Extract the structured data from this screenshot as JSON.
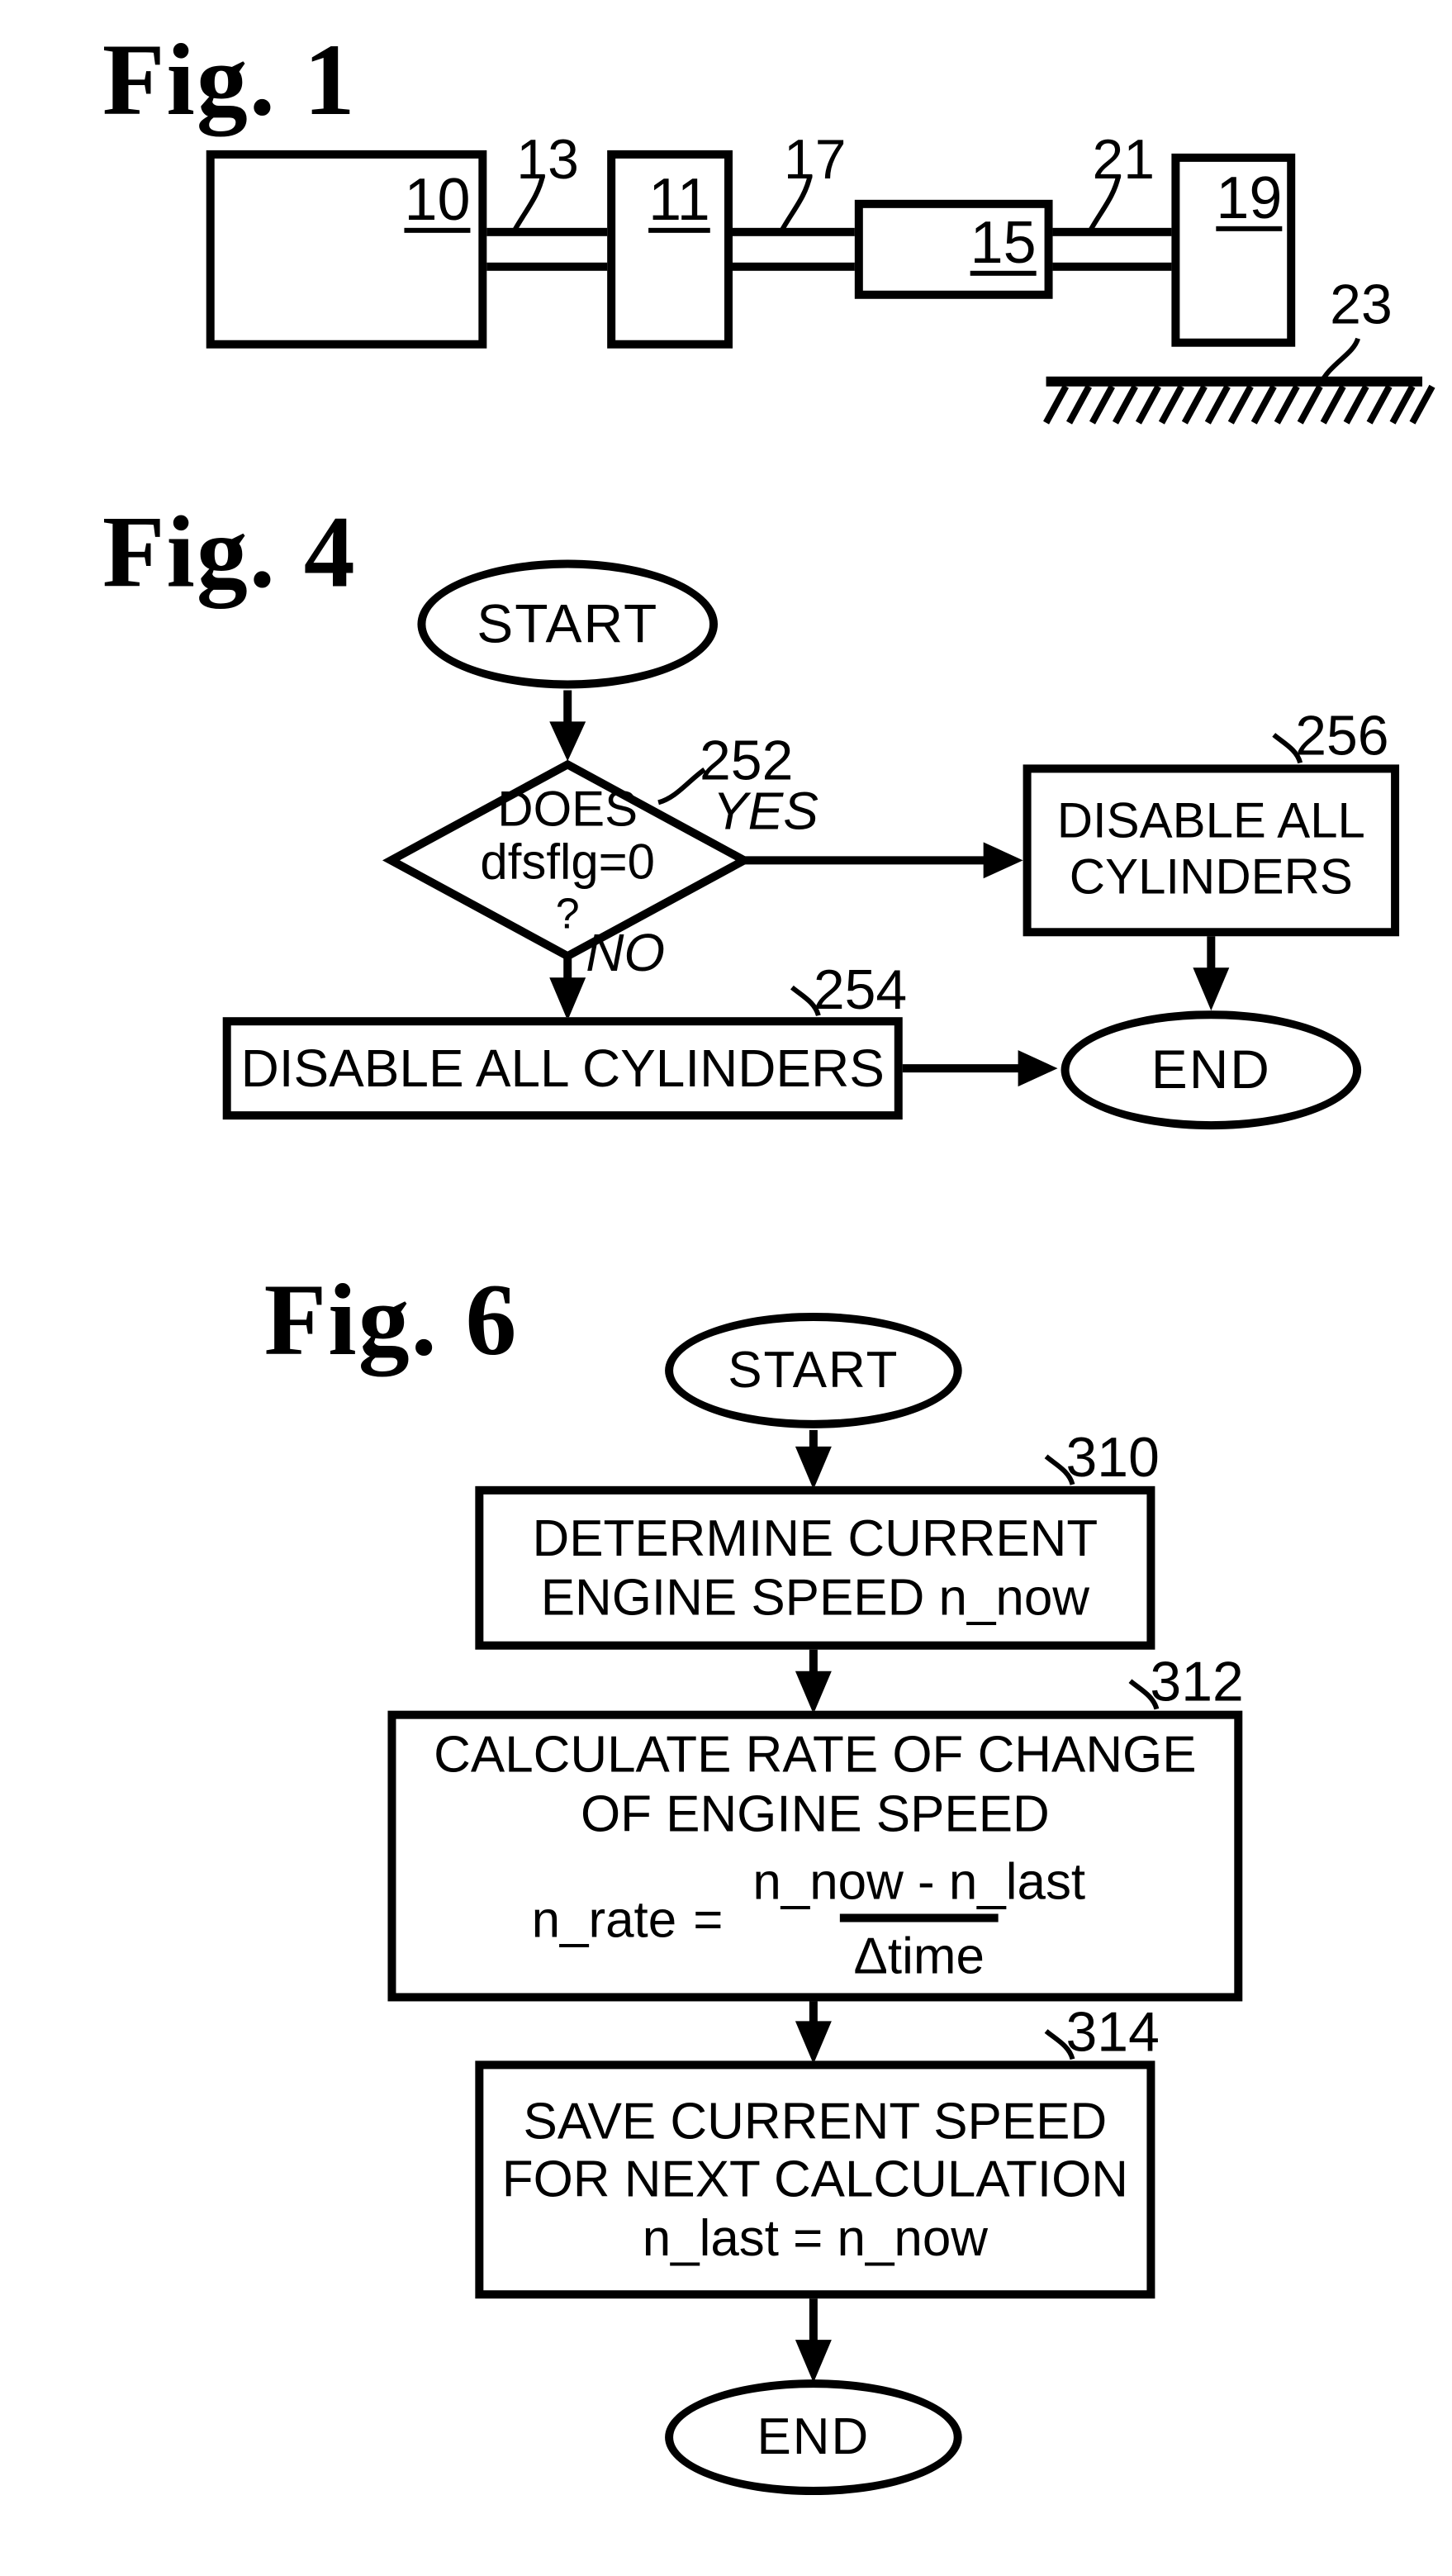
{
  "sheet": {
    "background": "#ffffff",
    "ink": "#000000"
  },
  "figures": [
    {
      "id": "figure-1",
      "label": "Fig. 1",
      "type": "block-diagram",
      "blocks": [
        {
          "ref": "10",
          "shape": "rectangle"
        },
        {
          "ref": "11",
          "shape": "rectangle"
        },
        {
          "ref": "15",
          "shape": "rectangle"
        },
        {
          "ref": "19",
          "shape": "rectangle"
        }
      ],
      "connectors": [
        {
          "ref": "13",
          "kind": "shaft"
        },
        {
          "ref": "17",
          "kind": "shaft"
        },
        {
          "ref": "21",
          "kind": "shaft"
        }
      ],
      "ground": {
        "ref": "23",
        "kind": "hatched-ground"
      }
    },
    {
      "id": "figure-4",
      "label": "Fig. 4",
      "type": "flowchart",
      "nodes": [
        {
          "id": "start",
          "shape": "ellipse",
          "text": "START"
        },
        {
          "id": "decision-252",
          "shape": "diamond",
          "ref": "252",
          "lines": [
            "DOES",
            "dfsflg=0",
            "?"
          ]
        },
        {
          "id": "step-256",
          "shape": "rectangle",
          "ref": "256",
          "lines": [
            "DISABLE ALL",
            "CYLINDERS"
          ]
        },
        {
          "id": "step-254",
          "shape": "rectangle",
          "ref": "254",
          "lines": [
            "DISABLE ALL CYLINDERS"
          ]
        },
        {
          "id": "end",
          "shape": "ellipse",
          "text": "END"
        }
      ],
      "branch_labels": {
        "yes": "YES",
        "no": "NO"
      }
    },
    {
      "id": "figure-6",
      "label": "Fig. 6",
      "type": "flowchart",
      "nodes": [
        {
          "id": "start",
          "shape": "ellipse",
          "text": "START"
        },
        {
          "id": "step-310",
          "shape": "rectangle",
          "ref": "310",
          "lines": [
            "DETERMINE CURRENT",
            "ENGINE SPEED n_now"
          ]
        },
        {
          "id": "step-312",
          "shape": "rectangle",
          "ref": "312",
          "lines": [
            "CALCULATE RATE OF CHANGE",
            "OF ENGINE SPEED"
          ],
          "equation": {
            "lhs": "n_rate",
            "operator": "=",
            "numerator": "n_now - n_last",
            "denominator": "Δtime"
          }
        },
        {
          "id": "step-314",
          "shape": "rectangle",
          "ref": "314",
          "lines": [
            "SAVE CURRENT SPEED",
            "FOR NEXT CALCULATION",
            "n_last = n_now"
          ]
        },
        {
          "id": "end",
          "shape": "ellipse",
          "text": "END"
        }
      ]
    }
  ],
  "fig1": {
    "label": "Fig. 1",
    "box10": "10",
    "box11": "11",
    "box15": "15",
    "box19": "19",
    "ref13": "13",
    "ref17": "17",
    "ref21": "21",
    "ref23": "23"
  },
  "fig4": {
    "label": "Fig. 4",
    "start": "START",
    "end": "END",
    "d1": "DOES",
    "d2": "dfsflg=0",
    "d3": "?",
    "ref252": "252",
    "ref254": "254",
    "ref256": "256",
    "yes": "YES",
    "no": "NO",
    "box256_l1": "DISABLE ALL",
    "box256_l2": "CYLINDERS",
    "box254_l1": "DISABLE ALL CYLINDERS"
  },
  "fig6": {
    "label": "Fig. 6",
    "start": "START",
    "end": "END",
    "ref310": "310",
    "ref312": "312",
    "ref314": "314",
    "box310_l1": "DETERMINE CURRENT",
    "box310_l2": "ENGINE SPEED n_now",
    "box312_l1": "CALCULATE RATE OF CHANGE",
    "box312_l2": "OF ENGINE SPEED",
    "eq_lhs": "n_rate",
    "eq_op": "=",
    "eq_num": "n_now - n_last",
    "eq_den": "Δtime",
    "box314_l1": "SAVE CURRENT SPEED",
    "box314_l2": "FOR NEXT CALCULATION",
    "box314_l3": "n_last = n_now"
  }
}
